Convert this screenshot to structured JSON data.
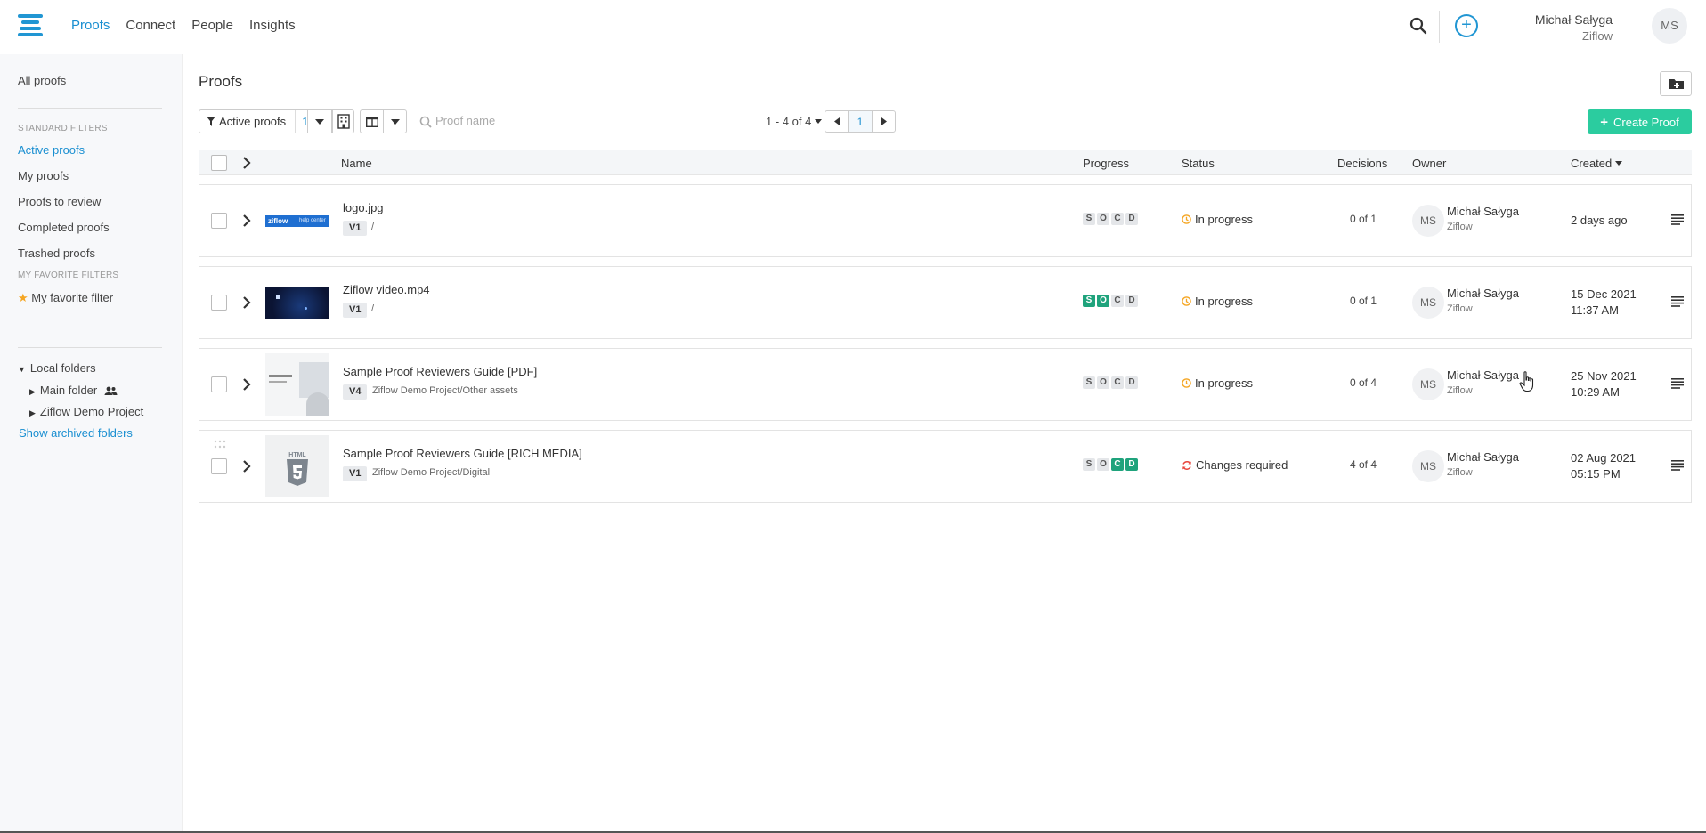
{
  "nav": {
    "items": [
      {
        "label": "Proofs",
        "active": true
      },
      {
        "label": "Connect",
        "active": false
      },
      {
        "label": "People",
        "active": false
      },
      {
        "label": "Insights",
        "active": false
      }
    ]
  },
  "user": {
    "name": "Michał Sałyga",
    "org": "Ziflow",
    "initials": "MS"
  },
  "sidebar": {
    "all_proofs": "All proofs",
    "standard_filters_heading": "STANDARD FILTERS",
    "filters": [
      "Active proofs",
      "My proofs",
      "Proofs to review",
      "Completed proofs",
      "Trashed proofs"
    ],
    "active_filter": "Active proofs",
    "favorite_heading": "MY FAVORITE FILTERS",
    "favorite_filter": "My favorite filter",
    "local_folders": "Local folders",
    "folders": [
      "Main folder",
      "Ziflow Demo Project"
    ],
    "show_archived": "Show archived folders"
  },
  "main": {
    "title": "Proofs",
    "filter_label": "Active proofs",
    "filter_count": "1",
    "search_placeholder": "Proof name",
    "pager_text": "1 - 4 of 4",
    "current_page": "1",
    "create_label": "Create Proof"
  },
  "table": {
    "headers": {
      "name": "Name",
      "progress": "Progress",
      "status": "Status",
      "decisions": "Decisions",
      "owner": "Owner",
      "created": "Created"
    },
    "rows": [
      {
        "name": "logo.jpg",
        "version": "V1",
        "path": "/",
        "progress": [
          "S",
          "O",
          "C",
          "D"
        ],
        "progress_done": [
          true,
          false,
          false,
          false
        ],
        "status": "In progress",
        "status_type": "progress",
        "decisions": "0 of 1",
        "owner_initials": "MS",
        "owner_name": "Michał Sałyga",
        "owner_org": "Ziflow",
        "created_line1": "2 days ago",
        "created_line2": "",
        "thumb": "logo"
      },
      {
        "name": "Ziflow video.mp4",
        "version": "V1",
        "path": "/",
        "progress": [
          "S",
          "O",
          "C",
          "D"
        ],
        "progress_done": [
          true,
          true,
          false,
          false
        ],
        "status": "In progress",
        "status_type": "progress",
        "decisions": "0 of 1",
        "owner_initials": "MS",
        "owner_name": "Michał Sałyga",
        "owner_org": "Ziflow",
        "created_line1": "15 Dec 2021",
        "created_line2": "11:37 AM",
        "thumb": "video"
      },
      {
        "name": "Sample Proof Reviewers Guide [PDF]",
        "version": "V4",
        "path": "Ziflow Demo Project/Other assets",
        "progress": [
          "S",
          "O",
          "C",
          "D"
        ],
        "progress_done": [
          false,
          false,
          false,
          false
        ],
        "status": "In progress",
        "status_type": "progress",
        "decisions": "0 of 4",
        "owner_initials": "MS",
        "owner_name": "Michał Sałyga",
        "owner_org": "Ziflow",
        "created_line1": "25 Nov 2021",
        "created_line2": "10:29 AM",
        "thumb": "pdf"
      },
      {
        "name": "Sample Proof Reviewers Guide [RICH MEDIA]",
        "version": "V1",
        "path": "Ziflow Demo Project/Digital",
        "progress": [
          "S",
          "O",
          "C",
          "D"
        ],
        "progress_done": [
          false,
          false,
          true,
          true
        ],
        "status": "Changes required",
        "status_type": "changes",
        "decisions": "4 of 4",
        "owner_initials": "MS",
        "owner_name": "Michał Sałyga",
        "owner_org": "Ziflow",
        "created_line1": "02 Aug 2021",
        "created_line2": "05:15 PM",
        "thumb": "html"
      }
    ]
  },
  "thumb_text": {
    "logo_brand": "ziflow",
    "logo_sub": "help center",
    "html_label": "HTML"
  },
  "colors": {
    "accent": "#1a8fd1",
    "create": "#2bcc9f",
    "progress_done": "#1fa37c",
    "in_progress": "#f5a623",
    "changes": "#e8453c"
  }
}
